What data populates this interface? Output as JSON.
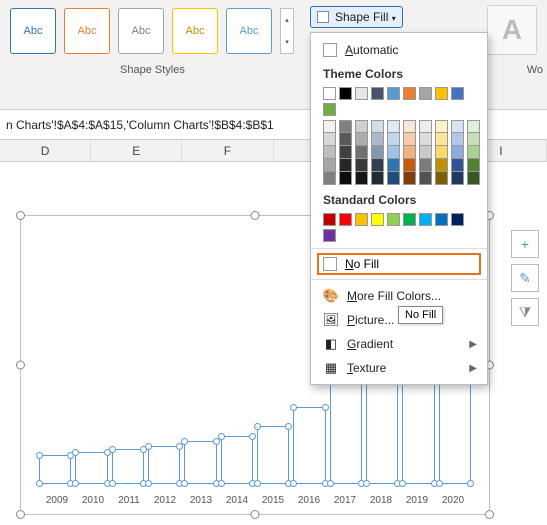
{
  "ribbon": {
    "style_label": "Abc",
    "group_label": "Shape Styles",
    "wo_label": "Wo",
    "big_a": "A"
  },
  "shape_fill": {
    "button_label": "Shape Fill",
    "automatic": "Automatic",
    "theme_header": "Theme Colors",
    "standard_header": "Standard Colors",
    "no_fill": "No Fill",
    "more_colors": "More Fill Colors...",
    "picture": "Picture...",
    "gradient": "Gradient",
    "texture": "Texture",
    "tooltip": "No Fill",
    "theme_row": [
      "#ffffff",
      "#000000",
      "#e7e6e6",
      "#44546a",
      "#5b9bd5",
      "#ed7d31",
      "#a5a5a5",
      "#ffc000",
      "#4472c4",
      "#70ad47"
    ],
    "tints": [
      [
        "#f2f2f2",
        "#d9d9d9",
        "#bfbfbf",
        "#a6a6a6",
        "#808080"
      ],
      [
        "#808080",
        "#595959",
        "#404040",
        "#262626",
        "#0d0d0d"
      ],
      [
        "#d0cece",
        "#aeabab",
        "#757070",
        "#3a3838",
        "#171616"
      ],
      [
        "#d6dce5",
        "#adb9ca",
        "#8497b0",
        "#323f4f",
        "#222a35"
      ],
      [
        "#deebf7",
        "#bdd7ee",
        "#9dc3e6",
        "#2e75b6",
        "#1f4e79"
      ],
      [
        "#fbe5d6",
        "#f8cbad",
        "#f4b183",
        "#c55a11",
        "#843c0c"
      ],
      [
        "#ededed",
        "#dbdbdb",
        "#c9c9c9",
        "#7b7b7b",
        "#525252"
      ],
      [
        "#fff2cc",
        "#fee599",
        "#ffd966",
        "#bf9000",
        "#7f6000"
      ],
      [
        "#dae3f3",
        "#b4c7e7",
        "#8faadc",
        "#2f5597",
        "#203864"
      ],
      [
        "#e2f0d9",
        "#c5e0b4",
        "#a9d18e",
        "#548235",
        "#385723"
      ]
    ],
    "standard": [
      "#c00000",
      "#ff0000",
      "#ffc000",
      "#ffff00",
      "#92d050",
      "#00b050",
      "#00b0f0",
      "#0070c0",
      "#002060",
      "#7030a0"
    ]
  },
  "formula": {
    "text": "n Charts'!$A$4:$A$15,'Column Charts'!$B$4:$B$1"
  },
  "columns": [
    "D",
    "E",
    "F",
    "",
    "",
    "I"
  ],
  "chart_side": {
    "plus": "+",
    "brush": "✎",
    "funnel": "⧩"
  },
  "chart_data": {
    "type": "bar",
    "title": "",
    "xlabel": "",
    "ylabel": "",
    "categories": [
      "2009",
      "2010",
      "2011",
      "2012",
      "2013",
      "2014",
      "2015",
      "2016",
      "2017",
      "2018",
      "2019",
      "2020"
    ],
    "values": [
      18,
      20,
      22,
      24,
      27,
      30,
      36,
      48,
      70,
      72,
      74,
      76
    ],
    "ylim": [
      0,
      80
    ],
    "selected_series": true,
    "fill": "none",
    "border": "#5b9bd5"
  }
}
